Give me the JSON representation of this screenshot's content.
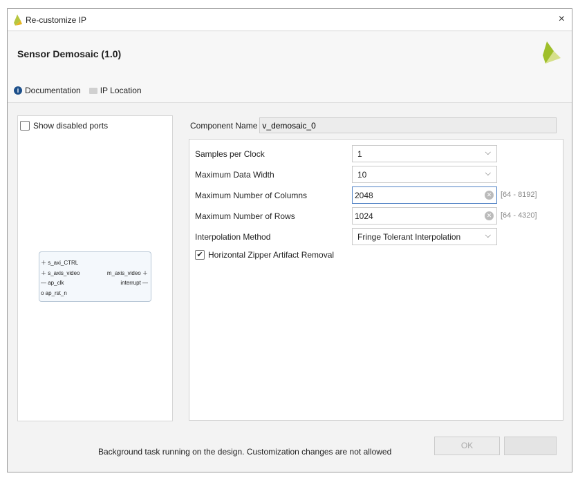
{
  "window": {
    "title": "Re-customize IP",
    "close": "×"
  },
  "header": {
    "title": "Sensor Demosaic (1.0)",
    "links": [
      {
        "label": "Documentation",
        "icon": "info-icon"
      },
      {
        "label": "IP Location",
        "icon": "folder-icon"
      }
    ]
  },
  "left": {
    "show_disabled_ports": "Show disabled ports",
    "block": {
      "ports_left": [
        "s_axi_CTRL",
        "s_axis_video",
        "ap_clk",
        "ap_rst_n"
      ],
      "ports_right": [
        "m_axis_video",
        "interrupt"
      ]
    }
  },
  "component": {
    "label": "Component Name",
    "value": "v_demosaic_0"
  },
  "params": [
    {
      "label": "Samples per Clock",
      "value": "1"
    },
    {
      "label": "Maximum Data Width",
      "value": "10"
    },
    {
      "label": "Maximum Number of Columns",
      "value": "2048",
      "range": "[64 - 8192]"
    },
    {
      "label": "Maximum Number of Rows",
      "value": "1024",
      "range": "[64 - 4320]"
    },
    {
      "label": "Interpolation Method",
      "value": "Fringe Tolerant Interpolation"
    }
  ],
  "zipper": {
    "label": "Horizontal Zipper Artifact Removal",
    "checked": true,
    "mark": "✔"
  },
  "footer": {
    "status": "Background task running on the design. Customization changes are not allowed",
    "ok": "OK"
  },
  "colors": {
    "accent": "#4d7fc4",
    "logo": "#8dbb2a"
  }
}
